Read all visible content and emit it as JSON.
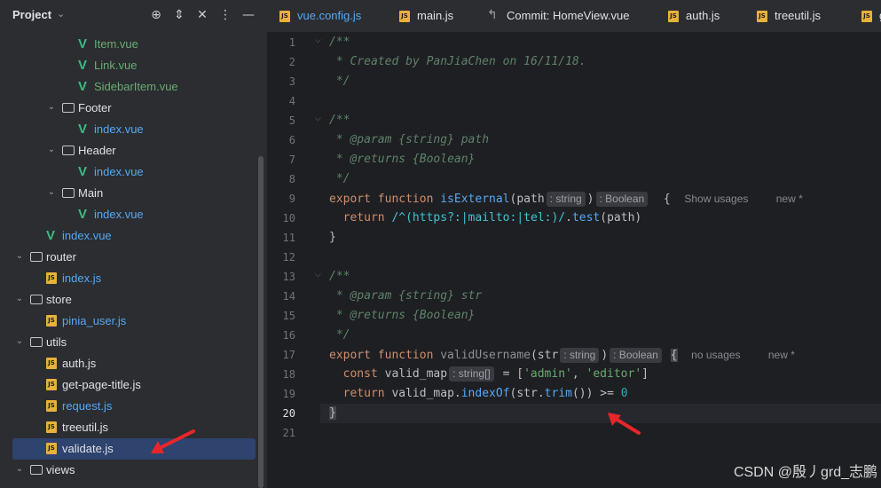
{
  "project": {
    "title": "Project"
  },
  "tree": [
    {
      "label": "Item.vue",
      "type": "vue",
      "color": "green",
      "indent": 5
    },
    {
      "label": "Link.vue",
      "type": "vue",
      "color": "green",
      "indent": 5
    },
    {
      "label": "SidebarItem.vue",
      "type": "vue",
      "color": "green",
      "indent": 5
    },
    {
      "label": "Footer",
      "type": "folder",
      "color": "white",
      "indent": 4
    },
    {
      "label": "index.vue",
      "type": "vue",
      "color": "blue",
      "indent": 5
    },
    {
      "label": "Header",
      "type": "folder",
      "color": "white",
      "indent": 4
    },
    {
      "label": "index.vue",
      "type": "vue",
      "color": "blue",
      "indent": 5
    },
    {
      "label": "Main",
      "type": "folder",
      "color": "white",
      "indent": 4
    },
    {
      "label": "index.vue",
      "type": "vue",
      "color": "blue",
      "indent": 5
    },
    {
      "label": "index.vue",
      "type": "vue",
      "color": "blue",
      "indent": 3
    },
    {
      "label": "router",
      "type": "folder",
      "color": "white",
      "indent": 2
    },
    {
      "label": "index.js",
      "type": "js",
      "color": "blue",
      "indent": 3
    },
    {
      "label": "store",
      "type": "folder",
      "color": "white",
      "indent": 2
    },
    {
      "label": "pinia_user.js",
      "type": "js",
      "color": "blue",
      "indent": 3
    },
    {
      "label": "utils",
      "type": "folder",
      "color": "white",
      "indent": 2
    },
    {
      "label": "auth.js",
      "type": "js",
      "color": "white",
      "indent": 3
    },
    {
      "label": "get-page-title.js",
      "type": "js",
      "color": "white",
      "indent": 3
    },
    {
      "label": "request.js",
      "type": "js",
      "color": "blue",
      "indent": 3
    },
    {
      "label": "treeutil.js",
      "type": "js",
      "color": "white",
      "indent": 3
    },
    {
      "label": "validate.js",
      "type": "js",
      "color": "white",
      "indent": 3,
      "selected": true
    },
    {
      "label": "views",
      "type": "folder",
      "color": "white",
      "indent": 2
    }
  ],
  "tabs": [
    {
      "label": "vue.config.js",
      "icon": "js",
      "color": "blue"
    },
    {
      "label": "main.js",
      "icon": "js",
      "color": "white"
    },
    {
      "label": "Commit: HomeView.vue",
      "icon": "commit",
      "color": "white"
    },
    {
      "label": "auth.js",
      "icon": "js",
      "color": "white"
    },
    {
      "label": "treeutil.js",
      "icon": "js",
      "color": "white"
    },
    {
      "label": "g",
      "icon": "js",
      "color": "white"
    }
  ],
  "line_numbers": [
    "1",
    "2",
    "3",
    "4",
    "5",
    "6",
    "7",
    "8",
    "9",
    "10",
    "11",
    "12",
    "13",
    "14",
    "15",
    "16",
    "17",
    "18",
    "19",
    "20",
    "21"
  ],
  "code": {
    "l1": "/**",
    "l2": " * Created by PanJiaChen on 16/11/18.",
    "l3": " */",
    "l5": "/**",
    "l6_pre": " * ",
    "l6_tag": "@param",
    "l6_rest": " {string} path",
    "l7_pre": " * ",
    "l7_tag": "@returns",
    "l7_rest": " {Boolean}",
    "l8": " */",
    "l9_kw": "export function ",
    "l9_fn": "isExternal",
    "l9_p": "(path",
    "l9_hint1": ": string",
    "l9_close": ")",
    "l9_hint2": ": Boolean",
    "l9_brace": "  {",
    "l9_usage": "Show usages",
    "l9_new": "new *",
    "l10_kw": "  return ",
    "l10_re": "/^(https?:|mailto:|tel:)/",
    "l10_dot": ".",
    "l10_fn": "test",
    "l10_rest": "(path)",
    "l11": "}",
    "l13": "/**",
    "l14_pre": " * ",
    "l14_tag": "@param",
    "l14_rest": " {string} str",
    "l15_pre": " * ",
    "l15_tag": "@returns",
    "l15_rest": " {Boolean}",
    "l16": " */",
    "l17_kw": "export function ",
    "l17_fn": "validUsername",
    "l17_p": "(str",
    "l17_hint1": ": string",
    "l17_close": ")",
    "l17_hint2": ": Boolean",
    "l17_brace": "{",
    "l17_usage": "no usages",
    "l17_new": "new *",
    "l18_kw": "  const ",
    "l18_id": "valid_map",
    "l18_hint": ": string[]",
    "l18_eq": " = [",
    "l18_s1": "'admin'",
    "l18_comma": ", ",
    "l18_s2": "'editor'",
    "l18_end": "]",
    "l19_kw": "  return ",
    "l19_id": "valid_map.",
    "l19_fn": "indexOf",
    "l19_p1": "(str.",
    "l19_fn2": "trim",
    "l19_p2": "()) >= ",
    "l19_num": "0",
    "l20": "}"
  },
  "current_line": "20",
  "watermark": "CSDN @殷丿grd_志鹏"
}
